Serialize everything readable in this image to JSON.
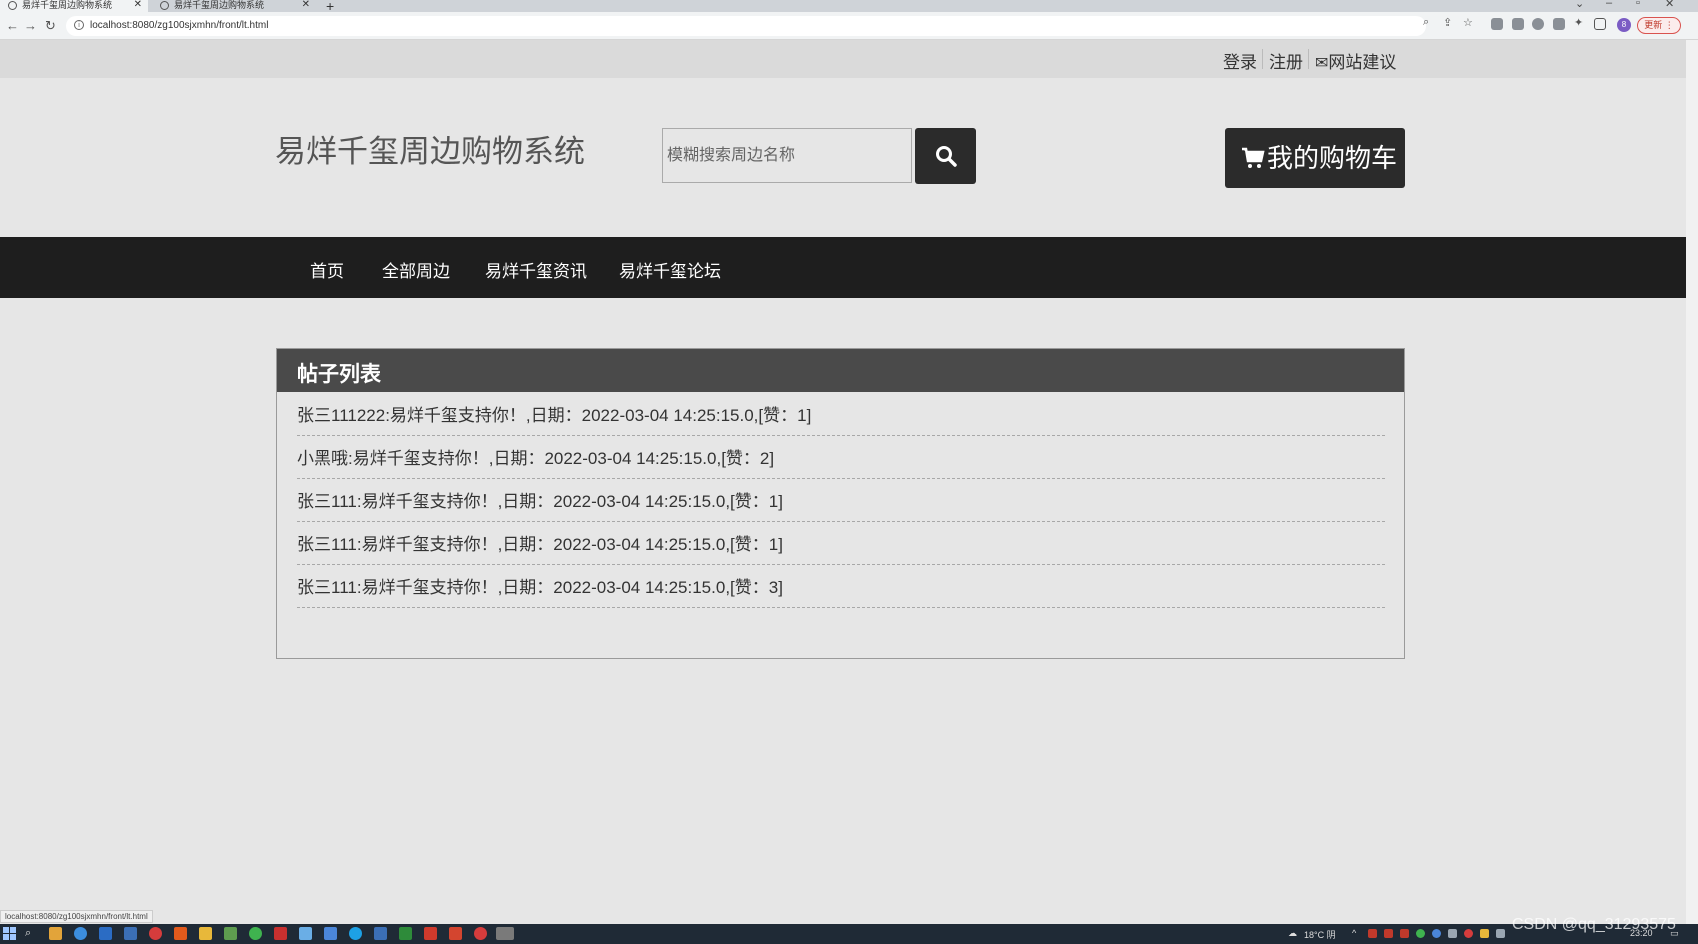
{
  "browser": {
    "tabs": [
      {
        "title": "易烊千玺周边购物系统",
        "active": true
      },
      {
        "title": "易烊千玺周边购物系统",
        "active": false
      }
    ],
    "url": "localhost:8080/zg100sjxmhn/front/lt.html",
    "update_label": "更新",
    "profile_initial": "8",
    "status_url": "localhost:8080/zg100sjxmhn/front/lt.html"
  },
  "topnav": {
    "login": "登录",
    "register": "注册",
    "feedback": "网站建议"
  },
  "header": {
    "site_title": "易烊千玺周边购物系统",
    "search_placeholder": "模糊搜索周边名称",
    "cart_label": "我的购物车"
  },
  "mainnav": {
    "items": [
      "首页",
      "全部周边",
      "易烊千玺资讯",
      "易烊千玺论坛"
    ]
  },
  "panel": {
    "title": "帖子列表",
    "posts": [
      "张三111222:易烊千玺支持你！,日期：2022-03-04 14:25:15.0,[赞：1]",
      "小黑哦:易烊千玺支持你！,日期：2022-03-04 14:25:15.0,[赞：2]",
      "张三111:易烊千玺支持你！,日期：2022-03-04 14:25:15.0,[赞：1]",
      "张三111:易烊千玺支持你！,日期：2022-03-04 14:25:15.0,[赞：1]",
      "张三111:易烊千玺支持你！,日期：2022-03-04 14:25:15.0,[赞：3]"
    ]
  },
  "taskbar": {
    "weather": "18°C 阴",
    "time": "23:20"
  },
  "watermark": "CSDN @qq_31293575",
  "colors": {
    "page_bg": "#e6e6e6",
    "dark": "#1e1e1e",
    "button": "#2b2b2b",
    "panel_header": "#4a4a4a"
  }
}
